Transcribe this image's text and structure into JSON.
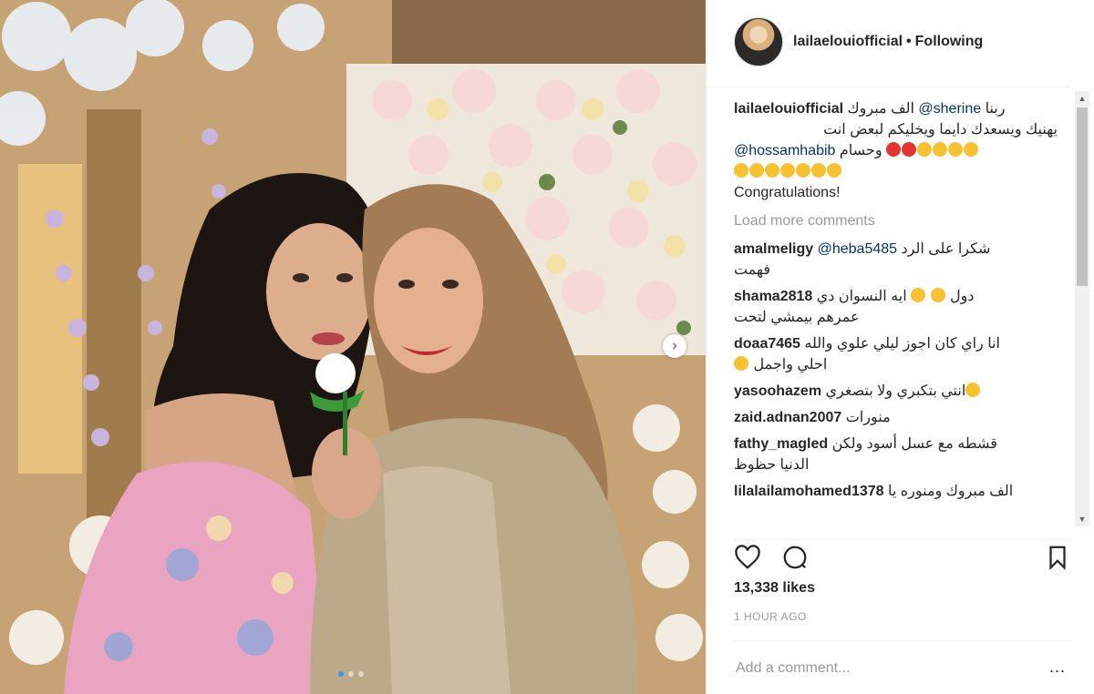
{
  "post": {
    "username": "lailaelouiofficial",
    "separator": "•",
    "follow_state": "Following"
  },
  "caption": {
    "username": "lailaelouiofficial",
    "line1_a": "ربنا",
    "mention1": "@sherine",
    "line1_b": "الف مبروك",
    "line2": "يهنيك ويسعدك دايما ويخليكم لبعض انت",
    "line3_a": "وحسام",
    "mention2": "@hossamhabib",
    "line5": "Congratulations!"
  },
  "load_more": "Load more comments",
  "comments": [
    {
      "user": "amalmeligy",
      "mention": "@heba5485",
      "text": "شكرا على الرد",
      "text2": "فهمت"
    },
    {
      "user": "shama2818",
      "text": "ايه النسوان دي",
      "text_b": "دول",
      "text2": "عمرهم بيمشي لتحت"
    },
    {
      "user": "doaa7465",
      "text": "انا راي كان اجوز ليلي علوي والله",
      "text2": "احلي واجمل"
    },
    {
      "user": "yasoohazem",
      "text": "انتي بتكبري ولا بتصغري"
    },
    {
      "user": "zaid.adnan2007",
      "text": "منورات"
    },
    {
      "user": "fathy_magled",
      "text": "قشطه مع عسل أسود ولكن",
      "text2": "الدنيا حظوظ"
    },
    {
      "user": "lilalailamohamed1378",
      "text": "الف مبروك ومنوره يا"
    }
  ],
  "likes": "13,338 likes",
  "time": "1 HOUR AGO",
  "add_comment_placeholder": "Add a comment...",
  "more_label": "...",
  "icons": [
    "heart-icon",
    "comment-icon",
    "bookmark-icon",
    "chevron-right-icon"
  ],
  "colors": {
    "accent": "#3897f0",
    "text": "#262626",
    "muted": "#999999",
    "mention": "#003569"
  }
}
